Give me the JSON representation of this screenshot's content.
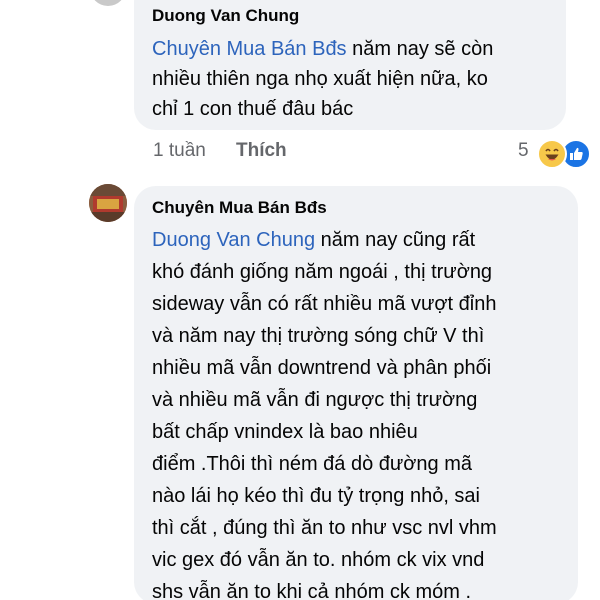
{
  "comment1": {
    "author": "Duong Van Chung",
    "mention": "Chuyên Mua Bán Bđs",
    "lines_first_rest": " năm nay sẽ còn",
    "lines": [
      "nhiều thiên nga nhọ xuất hiện nữa, ko",
      "chỉ 1 con thuế đâu bác"
    ],
    "time": "1 tuần",
    "like_label": "Thích",
    "reaction_count": "5",
    "reaction_icons": [
      "haha-icon",
      "like-icon"
    ]
  },
  "comment2": {
    "author": "Chuyên Mua Bán Bđs",
    "mention": "Duong Van Chung",
    "lines_first_rest": " năm nay cũng rất",
    "lines": [
      "khó đánh giống năm ngoái , thị trường",
      "sideway vẫn có rất nhiều mã vượt đỉnh",
      "và năm nay thị trường sóng chữ V thì",
      "nhiều mã vẫn downtrend và phân phối",
      "và nhiều mã vẫn đi ngược thị trường",
      "bất chấp vnindex là bao nhiêu",
      "điểm .Thôi thì ném đá dò đường mã",
      "nào lái họ kéo thì đu tỷ trọng nhỏ, sai",
      "thì cắt , đúng thì ăn to như vsc nvl vhm",
      "vic gex đó vẫn ăn to. nhóm ck vix vnd",
      "shs vẫn ăn to khi cả nhóm ck móm ."
    ]
  },
  "colors": {
    "bubble": "#f0f2f5",
    "mention": "#2d64bc",
    "meta_text": "#65676b",
    "like_blue": "#1b74e4"
  }
}
